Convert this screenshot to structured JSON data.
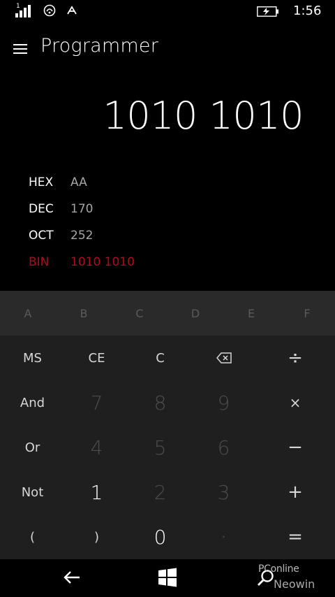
{
  "status_bar": {
    "signal_label": "1",
    "time": "1:56",
    "icons": [
      "signal-icon",
      "wifi-icon",
      "data-sense-icon",
      "battery-charging-icon"
    ]
  },
  "header": {
    "title": "Programmer"
  },
  "display": {
    "value": "1010 1010"
  },
  "radix": [
    {
      "label": "HEX",
      "value": "AA"
    },
    {
      "label": "DEC",
      "value": "170"
    },
    {
      "label": "OCT",
      "value": "252"
    },
    {
      "label": "BIN",
      "value": "1010 1010"
    }
  ],
  "hex_keys": [
    "A",
    "B",
    "C",
    "D",
    "E",
    "F"
  ],
  "keys": {
    "ms": "MS",
    "ce": "CE",
    "c": "C",
    "backspace": "backspace-icon",
    "divide": "÷",
    "and": "And",
    "seven": "7",
    "eight": "8",
    "nine": "9",
    "multiply": "×",
    "or": "Or",
    "four": "4",
    "five": "5",
    "six": "6",
    "minus": "−",
    "not": "Not",
    "one": "1",
    "two": "2",
    "three": "3",
    "plus": "+",
    "open_paren": "(",
    "close_paren": ")",
    "zero": "0",
    "dot": "·",
    "equals": "="
  },
  "watermark": {
    "line1": "PConline",
    "line2": "Neowin"
  },
  "colors": {
    "accent": "#b00a1e",
    "keypad_bg": "#1f1f1f",
    "hex_row_bg": "#2a2a2a"
  }
}
